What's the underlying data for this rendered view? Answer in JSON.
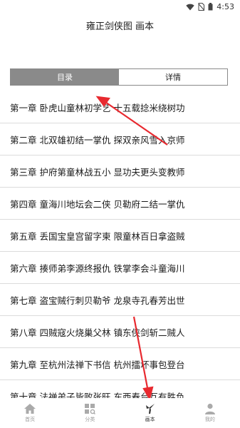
{
  "status_bar": {
    "time": "4:53"
  },
  "header": {
    "title": "雍正剑侠图 画本"
  },
  "tabs": [
    {
      "label": "目录",
      "active": true
    },
    {
      "label": "详情",
      "active": false
    }
  ],
  "chapters": [
    "第一章 卧虎山童林初学艺 十五载捻米绕树功",
    "第二章 北双雄初结一掌仇 探双亲风雪入京师",
    "第三章 护府第童林战五小 显功夫更头变教师",
    "第四章 童海川地坛会二侠 贝勒府二结一掌仇",
    "第五章 丢国宝皇宫留字柬 限童林百日拿盗贼",
    "第六章 揍师弟李源终报仇 铁掌李会斗童海川",
    "第七章 盗宝贼行刺贝勒爷 龙泉寺孔春芳出世",
    "第八章 四贼寇火烧巢父林 镇东侠剑斩二贼人",
    "第九章 至杭州法禅下书信 杭州擂坏事包登台",
    "第十章 法禅弟子皆败张旺 东西春台互有胜负"
  ],
  "bottom_nav": [
    {
      "label": "首页",
      "icon": "home-icon",
      "active": false
    },
    {
      "label": "分类",
      "icon": "category-icon",
      "active": false
    },
    {
      "label": "画本",
      "icon": "brush-icon",
      "active": true
    },
    {
      "label": "我的",
      "icon": "profile-icon",
      "active": false
    }
  ],
  "colors": {
    "annotation_arrow": "#e8292f",
    "tab_active_bg": "#8a8a8a"
  }
}
